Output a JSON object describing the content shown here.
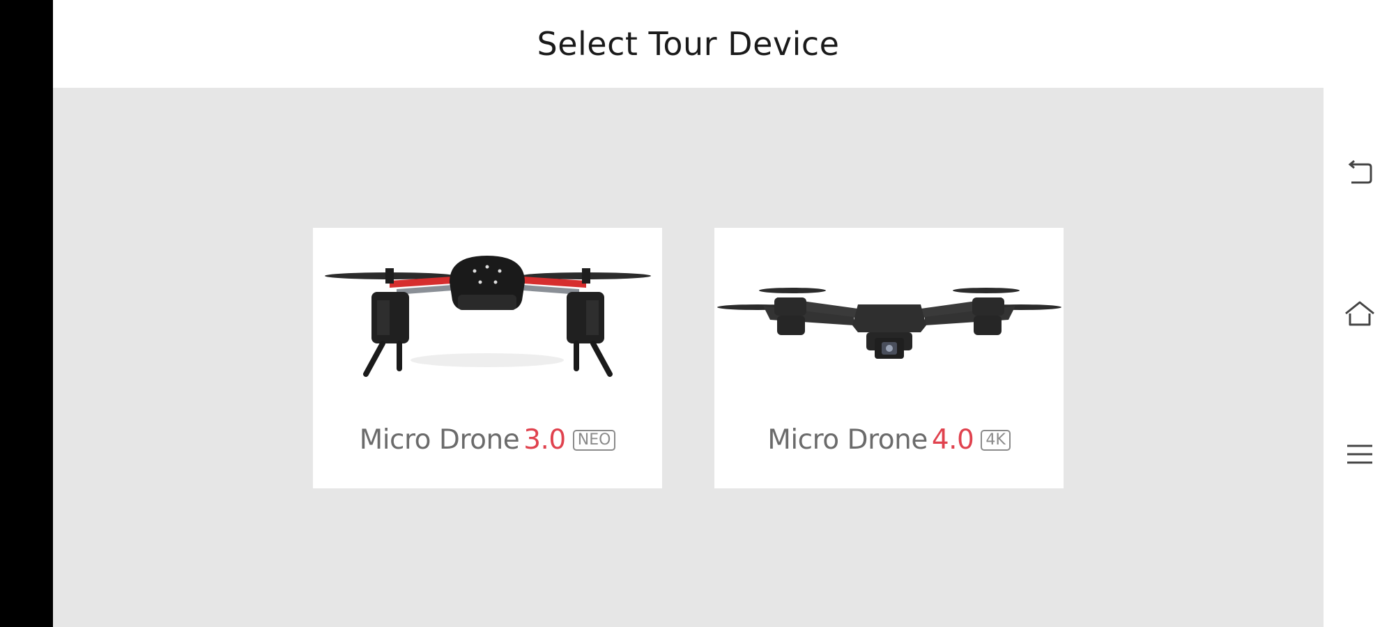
{
  "header": {
    "title": "Select Tour Device"
  },
  "devices": [
    {
      "name": "Micro Drone",
      "version": "3.0",
      "badge": "NEO",
      "image_alt": "Micro Drone 3.0 quadcopter"
    },
    {
      "name": "Micro Drone",
      "version": "4.0",
      "badge": "4K",
      "image_alt": "Micro Drone 4.0 foldable quadcopter"
    }
  ],
  "nav": {
    "back_icon": "back-icon",
    "home_icon": "home-icon",
    "menu_icon": "menu-icon"
  },
  "colors": {
    "accent": "#e0424e",
    "content_background": "#e6e6e6",
    "side_bar": "#000000"
  }
}
